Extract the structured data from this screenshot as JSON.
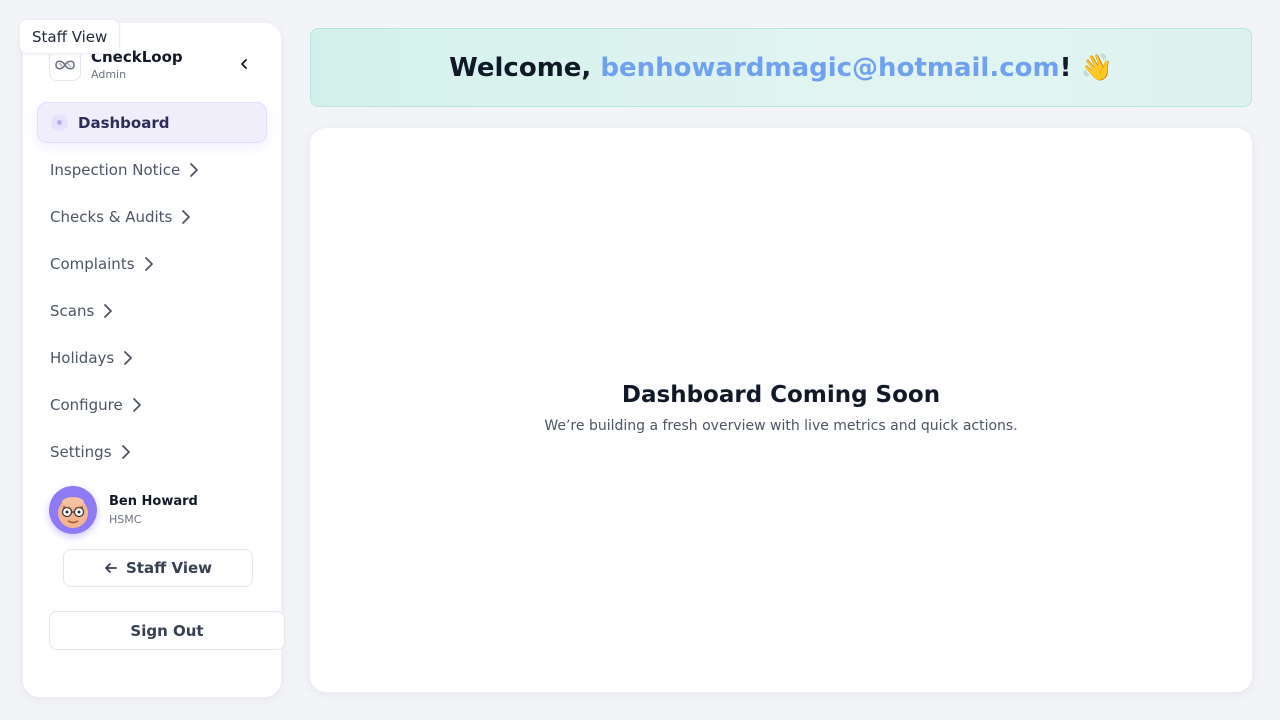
{
  "tooltip": {
    "label": "Staff View"
  },
  "brand": {
    "name": "CheckLoop",
    "role": "Admin"
  },
  "nav": {
    "active": {
      "label": "Dashboard"
    },
    "items": [
      {
        "label": "Inspection Notice"
      },
      {
        "label": "Checks & Audits"
      },
      {
        "label": "Complaints"
      },
      {
        "label": "Scans"
      },
      {
        "label": "Holidays"
      },
      {
        "label": "Configure"
      },
      {
        "label": "Settings"
      }
    ]
  },
  "profile": {
    "name": "Ben Howard",
    "org": "HSMC"
  },
  "buttons": {
    "staff_view": "Staff View",
    "sign_out": "Sign Out"
  },
  "welcome": {
    "prefix": "Welcome, ",
    "email": "benhowardmagic@hotmail.com",
    "suffix": "! 👋"
  },
  "main": {
    "title": "Dashboard Coming Soon",
    "subtitle": "We’re building a fresh overview with live metrics and quick actions."
  },
  "colors": {
    "accent": "#7c5cf6",
    "email_link": "#6fa1f0",
    "banner_bg": "#d9f3ee",
    "active_nav_bg": "#f1eefc"
  },
  "icons": {
    "brand": "infinity-logo-icon",
    "collapse": "chevron-left-icon",
    "active_nav": "dot-icon",
    "nav_expand": "chevron-right-icon",
    "staff_view": "arrow-left-icon"
  }
}
